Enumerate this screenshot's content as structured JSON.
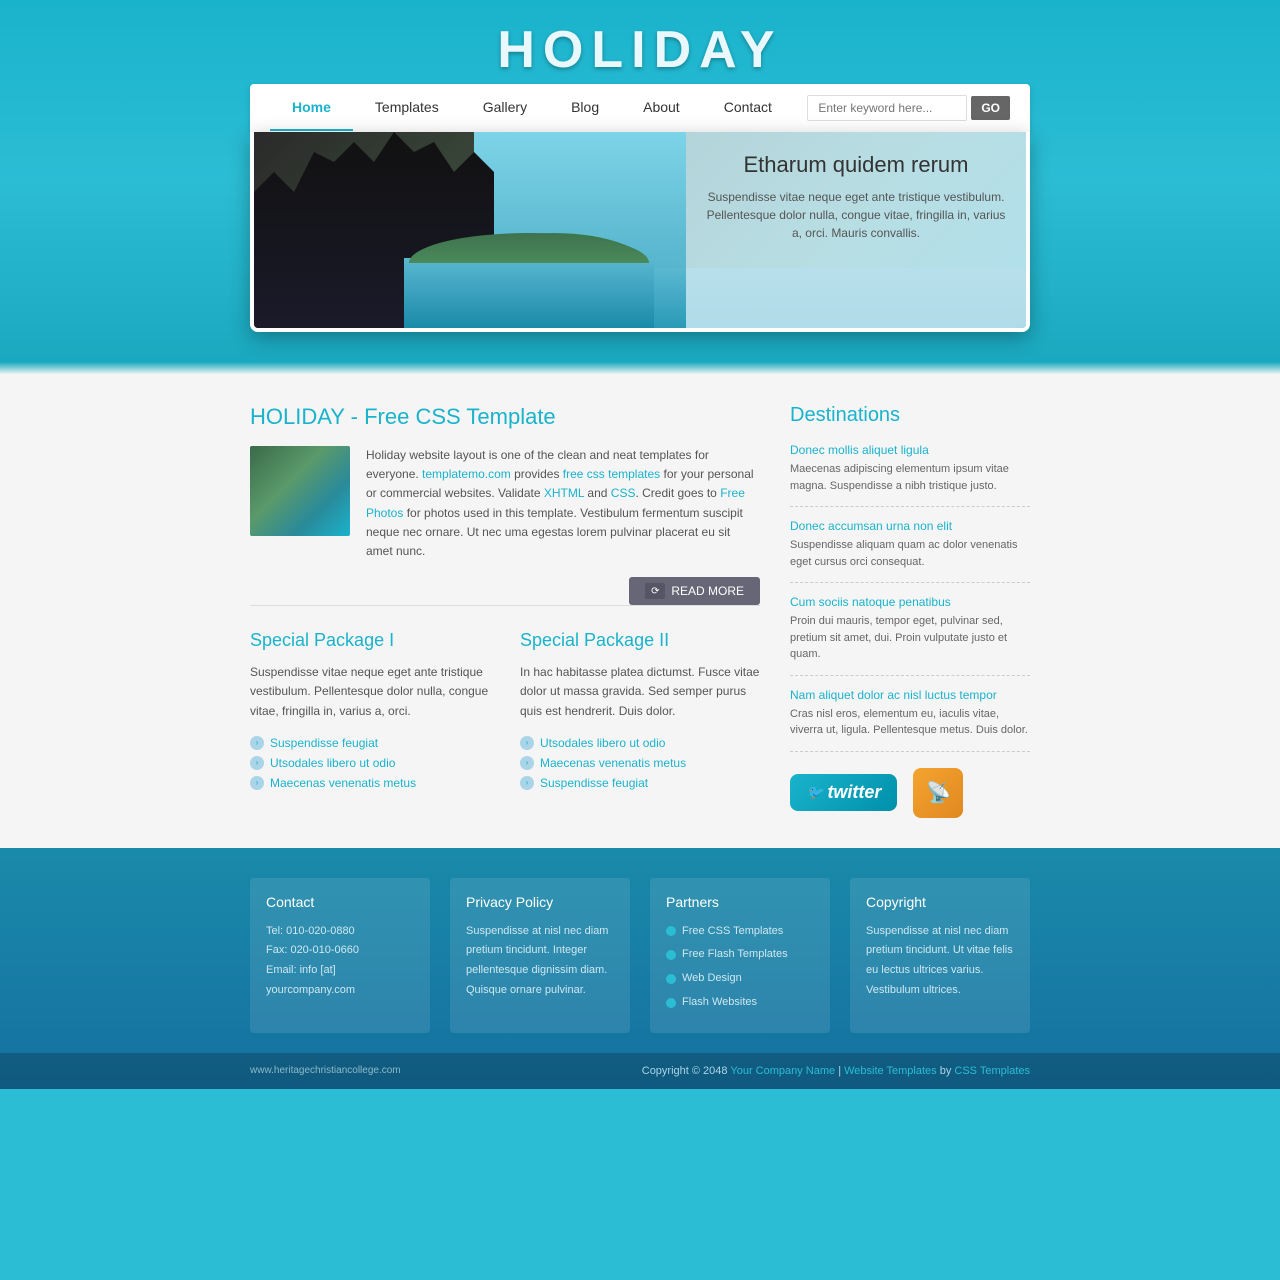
{
  "site": {
    "title": "HOLIDAY",
    "url": "www.heritagechristiancollege.com"
  },
  "nav": {
    "links": [
      {
        "label": "Home",
        "active": true
      },
      {
        "label": "Templates",
        "active": false
      },
      {
        "label": "Gallery",
        "active": false
      },
      {
        "label": "Blog",
        "active": false
      },
      {
        "label": "About",
        "active": false
      },
      {
        "label": "Contact",
        "active": false
      }
    ],
    "search_placeholder": "Enter keyword here...",
    "search_button": "GO"
  },
  "hero": {
    "title": "Etharum quidem rerum",
    "text": "Suspendisse vitae neque eget ante tristique vestibulum. Pellentesque dolor nulla, congue vitae, fringilla in, varius a, orci. Mauris convallis."
  },
  "about": {
    "heading": "HOLIDAY - Free CSS Template",
    "body": "Holiday website layout is one of the clean and neat templates for everyone. templatemo.com provides free css templates for your personal or commercial websites. Validate XHTML and CSS. Credit goes to Free Photos for photos used in this template. Vestibulum fermentum suscipit neque nec ornare. Ut nec uma egestas lorem pulvinar placerat eu sit amet nunc.",
    "read_more": "READ MORE"
  },
  "packages": [
    {
      "title": "Special Package I",
      "text": "Suspendisse vitae neque eget ante tristique vestibulum. Pellentesque dolor nulla, congue vitae, fringilla in, varius a, orci.",
      "items": [
        "Suspendisse feugiat",
        "Utsodales libero ut odio",
        "Maecenas venenatis metus"
      ]
    },
    {
      "title": "Special Package II",
      "text": "In hac habitasse platea dictumst. Fusce vitae dolor ut massa gravida. Sed semper purus quis est hendrerit. Duis dolor.",
      "items": [
        "Utsodales libero ut odio",
        "Maecenas venenatis metus",
        "Suspendisse feugiat"
      ]
    }
  ],
  "destinations": {
    "heading": "Destinations",
    "items": [
      {
        "title": "Donec mollis aliquet ligula",
        "text": "Maecenas adipiscing elementum ipsum vitae magna. Suspendisse a nibh tristique justo."
      },
      {
        "title": "Donec accumsan urna non elit",
        "text": "Suspendisse aliquam quam ac dolor venenatis eget cursus orci consequat."
      },
      {
        "title": "Cum sociis natoque penatibus",
        "text": "Proin dui mauris, tempor eget, pulvinar sed, pretium sit amet, dui. Proin vulputate justo et quam."
      },
      {
        "title": "Nam aliquet dolor ac nisl luctus tempor",
        "text": "Cras nisl eros, elementum eu, iaculis vitae, viverra ut, ligula. Pellentesque metus. Duis dolor."
      }
    ]
  },
  "footer": {
    "columns": [
      {
        "heading": "Contact",
        "lines": [
          "Tel: 010-020-0880",
          "Fax: 020-010-0660",
          "Email: info [at] yourcompany.com"
        ]
      },
      {
        "heading": "Privacy Policy",
        "text": "Suspendisse at nisl nec diam pretium tincidunt. Integer pellentesque dignissim diam. Quisque ornare pulvinar."
      },
      {
        "heading": "Partners",
        "links": [
          "Free CSS Templates",
          "Free Flash Templates",
          "Web Design",
          "Flash Websites"
        ]
      },
      {
        "heading": "Copyright",
        "text": "Suspendisse at nisl nec diam pretium tincidunt. Ut vitae felis eu lectus ultrices varius. Vestibulum ultrices."
      }
    ],
    "copyright": "Copyright © 2048",
    "company": "Your Company Name",
    "site_templates": "Website Templates",
    "css_templates": "CSS Templates"
  }
}
